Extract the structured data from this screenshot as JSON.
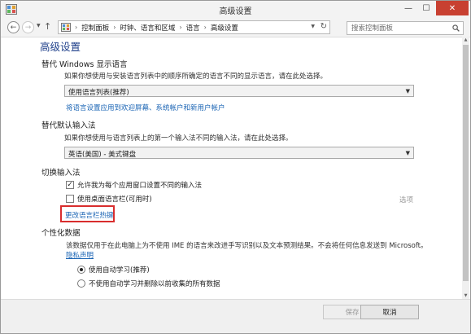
{
  "window": {
    "title": "高级设置"
  },
  "window_controls": {
    "minimize": "—",
    "maximize": "☐",
    "close": "✕"
  },
  "nav": {
    "back": "←",
    "forward": "→",
    "up": "↑",
    "breadcrumbs": [
      "控制面板",
      "时钟、语言和区域",
      "语言",
      "高级设置"
    ],
    "search_placeholder": "搜索控制面板"
  },
  "page": {
    "title": "高级设置"
  },
  "display_language": {
    "heading": "替代 Windows 显示语言",
    "description": "如果你想使用与安装语言列表中的顺序所确定的语言不同的显示语言，请在此处选择。",
    "selected": "使用语言列表(推荐)",
    "apply_link": "将语言设置应用到欢迎屏幕、系统帐户和新用户帐户"
  },
  "input_method": {
    "heading": "替代默认输入法",
    "description": "如果你想使用与语言列表上的第一个输入法不同的输入法，请在此处选择。",
    "selected": "英语(美国) - 美式键盘"
  },
  "switch_input": {
    "heading": "切换输入法",
    "per_app_label": "允许我为每个应用窗口设置不同的输入法",
    "per_app_checked": true,
    "desktop_bar_label": "使用桌面语言栏(可用时)",
    "desktop_bar_checked": false,
    "options_link": "选项",
    "hotkeys_link": "更改语言栏热键"
  },
  "personalization": {
    "heading": "个性化数据",
    "description": "该数据仅用于在此电脑上为不使用 IME 的语言来改进手写识别以及文本预测结果。不会将任何信息发送到 Microsoft。",
    "privacy_link": "隐私声明",
    "option_auto": "使用自动学习(推荐)",
    "option_no_auto": "不使用自动学习并删除以前收集的所有数据",
    "selected": "option_auto"
  },
  "footer": {
    "save": "保存",
    "cancel": "取消"
  },
  "colors": {
    "accent_link": "#1a64b4",
    "title_blue": "#1e3f8a",
    "close_red": "#c84031",
    "highlight_red": "#d92d2d"
  }
}
